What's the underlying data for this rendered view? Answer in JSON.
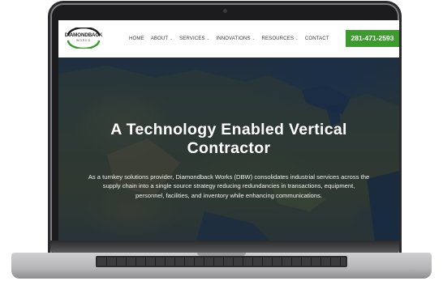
{
  "brand": {
    "name": "DIAMONDBACK",
    "sub": "WORKS",
    "ring_color": "#3c9a2f"
  },
  "nav": {
    "items": [
      {
        "label": "HOME",
        "has_dropdown": false
      },
      {
        "label": "ABOUT",
        "has_dropdown": true
      },
      {
        "label": "SERVICES",
        "has_dropdown": true
      },
      {
        "label": "INNOVATIONS",
        "has_dropdown": true
      },
      {
        "label": "RESOURCES",
        "has_dropdown": true
      },
      {
        "label": "CONTACT",
        "has_dropdown": false
      }
    ],
    "dropdown_glyph": "⌄",
    "phone": "281-471-2593",
    "phone_color": "#3c9a2f"
  },
  "hero": {
    "title": "A Technology Enabled Vertical Contractor",
    "text": "As a turnkey solutions provider, Diamondback Works (DBW) consolidates industrial services across the supply chain into a single source strategy reducing redundancies in transactions, equipment, personnel, facilities, and inventory while enhancing communications.",
    "background": "satellite-map-image"
  }
}
